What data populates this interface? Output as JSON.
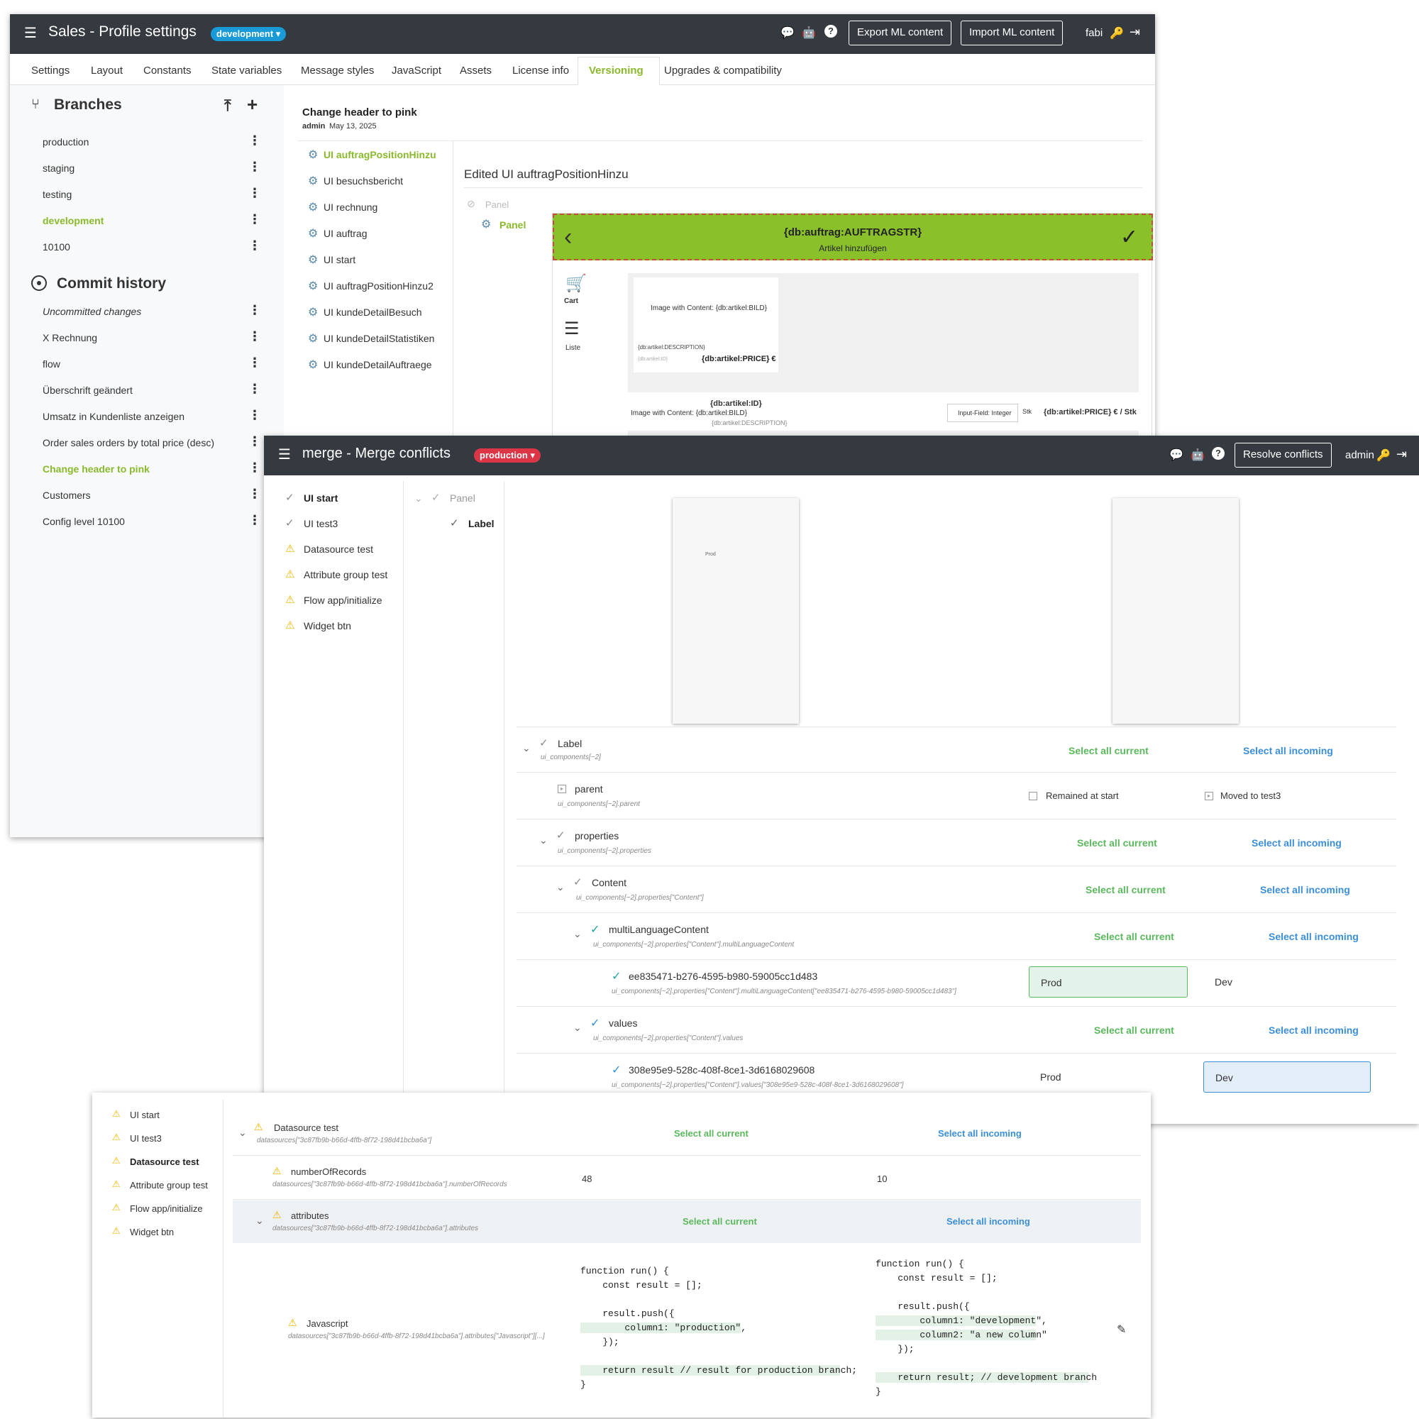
{
  "win1": {
    "title": "Sales - Profile settings",
    "branch_badge": "development ▾",
    "export_btn": "Export ML content",
    "import_btn": "Import ML content",
    "user": "fabi",
    "tabs": [
      "Settings",
      "Layout",
      "Constants",
      "State variables",
      "Message styles",
      "JavaScript",
      "Assets",
      "License info",
      "Versioning",
      "Upgrades & compatibility"
    ],
    "branches_title": "Branches",
    "branches": [
      "production",
      "staging",
      "testing",
      "development",
      "10100"
    ],
    "commit_title": "Commit history",
    "commits": [
      "Uncommitted changes",
      "X Rechnung",
      "flow",
      "Überschrift geändert",
      "Umsatz in Kundenliste anzeigen",
      "Order sales orders by total price (desc)",
      "Change header to pink",
      "Customers",
      "Config level 10100"
    ],
    "commit_detail": {
      "title": "Change header to pink",
      "author": "admin",
      "date": "May 13, 2025"
    },
    "ui_list": [
      "UI auftragPositionHinzu",
      "UI besuchsbericht",
      "UI rechnung",
      "UI auftrag",
      "UI start",
      "UI auftragPositionHinzu2",
      "UI kundeDetailBesuch",
      "UI kundeDetailStatistiken",
      "UI kundeDetailAuftraege"
    ],
    "edited_title": "Edited UI auftragPositionHinzu",
    "tree": {
      "panel_removed": "Panel",
      "panel": "Panel"
    },
    "preview": {
      "header_title": "{db:auftrag:AUFTRAGSTR}",
      "header_sub": "Artikel hinzufügen",
      "cart_label": "Cart",
      "list_label": "Liste",
      "image_content": "Image with Content: {db:artikel:BILD}",
      "description": "{db:artikel:DESCRIPTION}",
      "id_small": "{db:artikel:ID}",
      "price": "{db:artikel:PRICE} €",
      "row_id": "{db:artikel:ID}",
      "row_image": "Image with Content: {db:artikel:BILD}",
      "row_desc": "{db:artikel:DESCRIPTION}",
      "input_field": "Input-Field: Integer",
      "stk": "Stk",
      "row_price": "{db:artikel:PRICE} € / Stk"
    }
  },
  "win2": {
    "title": "merge - Merge conflicts",
    "branch_badge": "production ▾",
    "resolve_btn": "Resolve conflicts",
    "user": "admin",
    "left_list": [
      "UI start",
      "UI test3",
      "Datasource test",
      "Attribute group test",
      "Flow app/initialize",
      "Widget btn"
    ],
    "mid_tree": [
      "Panel",
      "Label"
    ],
    "preview_prod_text": "Prod",
    "select_all_current": "Select all current",
    "select_all_incoming": "Select all incoming",
    "rows": {
      "label": {
        "name": "Label",
        "path": "ui_components[~2]"
      },
      "parent": {
        "name": "parent",
        "path": "ui_components[~2].parent",
        "current": "Remained at start",
        "incoming": "Moved to test3"
      },
      "properties": {
        "name": "properties",
        "path": "ui_components[~2].properties"
      },
      "content": {
        "name": "Content",
        "path": "ui_components[~2].properties[\"Content\"]"
      },
      "mlc": {
        "name": "multiLanguageContent",
        "path": "ui_components[~2].properties[\"Content\"].multiLanguageContent"
      },
      "ee": {
        "name": "ee835471-b276-4595-b980-59005cc1d483",
        "path": "ui_components[~2].properties[\"Content\"].multiLanguageContent[\"ee835471-b276-4595-b980-59005cc1d483\"]",
        "current": "Prod",
        "incoming": "Dev"
      },
      "values": {
        "name": "values",
        "path": "ui_components[~2].properties[\"Content\"].values"
      },
      "v308": {
        "name": "308e95e9-528c-408f-8ce1-3d6168029608",
        "path": "ui_components[~2].properties[\"Content\"].values[\"308e95e9-528c-408f-8ce1-3d6168029608\"]",
        "current": "Prod",
        "incoming": "Dev"
      }
    }
  },
  "win3": {
    "left_list": [
      "UI start",
      "UI test3",
      "Datasource test",
      "Attribute group test",
      "Flow app/initialize",
      "Widget btn"
    ],
    "ds": {
      "name": "Datasource test",
      "path": "datasources[\"3c87fb9b-b66d-4ffb-8f72-198d41bcba6a\"]"
    },
    "nrec": {
      "name": "numberOfRecords",
      "path": "datasources[\"3c87fb9b-b66d-4ffb-8f72-198d41bcba6a\"].numberOfRecords",
      "current": "48",
      "incoming": "10"
    },
    "attrs": {
      "name": "attributes",
      "path": "datasources[\"3c87fb9b-b66d-4ffb-8f72-198d41bcba6a\"].attributes"
    },
    "js": {
      "name": "Javascript",
      "path": "datasources[\"3c87fb9b-b66d-4ffb-8f72-198d41bcba6a\"].attributes[\"Javascript\"][...]"
    },
    "code_current": [
      "function run() {",
      "    const result = [];",
      "",
      "    result.push({",
      "        column1: \"production\",",
      "    });",
      "",
      "    return result // result for production branch;",
      "}"
    ],
    "code_incoming": [
      "function run() {",
      "    const result = [];",
      "",
      "    result.push({",
      "        column1: \"development\",",
      "        column2: \"a new column\"",
      "    });",
      "",
      "    return result; // development branch",
      "}"
    ]
  }
}
